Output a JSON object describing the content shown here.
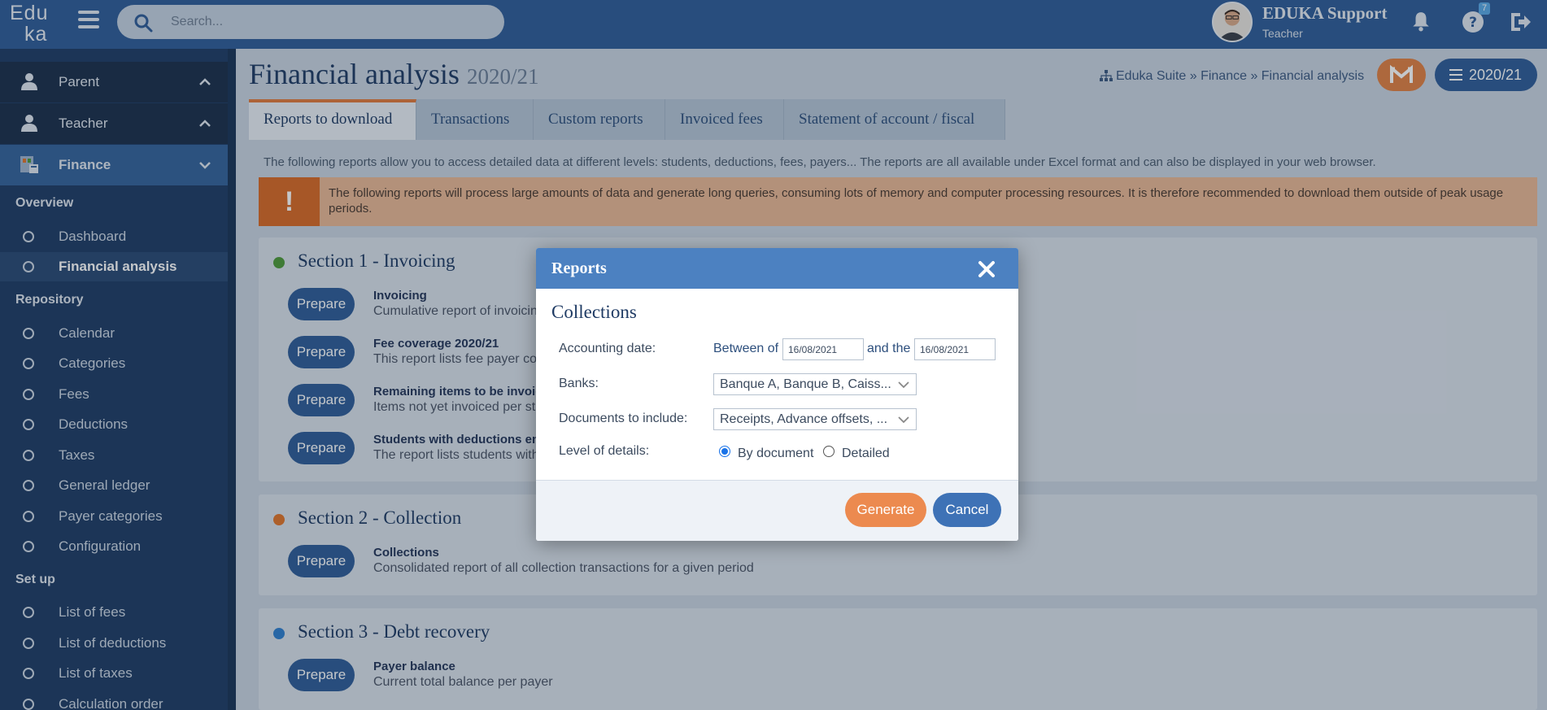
{
  "app": {
    "logo_line1": "Edu",
    "logo_line2": "ka",
    "search_placeholder": "Search...",
    "user_name": "EDUKA Support",
    "user_role": "Teacher",
    "help_badge": "7"
  },
  "sidebar": {
    "rows": [
      {
        "label": "Parent"
      },
      {
        "label": "Teacher"
      },
      {
        "label": "Finance"
      }
    ],
    "sections": [
      {
        "heading": "Overview",
        "items": [
          "Dashboard",
          "Financial analysis"
        ]
      },
      {
        "heading": "Repository",
        "items": [
          "Calendar",
          "Categories",
          "Fees",
          "Deductions",
          "Taxes",
          "General ledger",
          "Payer categories",
          "Configuration"
        ]
      },
      {
        "heading": "Set up",
        "items": [
          "List of fees",
          "List of deductions",
          "List of taxes",
          "Calculation order"
        ]
      }
    ]
  },
  "main": {
    "title": "Financial analysis",
    "title_year": "2020/21",
    "breadcrumb": "Eduka Suite » Finance » Financial analysis",
    "year_button": "2020/21",
    "tabs": [
      "Reports to download",
      "Transactions",
      "Custom reports",
      "Invoiced fees",
      "Statement of account / fiscal"
    ],
    "intro": "The following reports allow you to access detailed data at different levels: students, deductions, fees, payers... The reports are all available under Excel format and can also be displayed in your web browser.",
    "warning": "The following reports will process large amounts of data and generate long queries, consuming lots of memory and computer processing resources. It is therefore recommended to download them outside of peak usage periods.",
    "prepare_label": "Prepare",
    "sections": [
      {
        "title": "Section 1 - Invoicing",
        "reports": [
          {
            "name": "Invoicing",
            "desc": "Cumulative report of invoicing, g"
          },
          {
            "name": "Fee coverage 2020/21",
            "desc": "This report lists fee payer cover"
          },
          {
            "name": "Remaining items to be invoiced",
            "desc": "Items not yet invoiced per stude"
          },
          {
            "name": "Students with deductions enabl",
            "desc": "The report lists students with at"
          }
        ]
      },
      {
        "title": "Section 2 - Collection",
        "reports": [
          {
            "name": "Collections",
            "desc": "Consolidated report of all collection transactions for a given period"
          }
        ]
      },
      {
        "title": "Section 3 - Debt recovery",
        "reports": [
          {
            "name": "Payer balance",
            "desc": "Current total balance per payer"
          }
        ]
      }
    ]
  },
  "modal": {
    "title": "Reports",
    "subtitle": "Collections",
    "accounting_label": "Accounting date:",
    "between_label": "Between of",
    "date_from": "16/08/2021",
    "and_label": "and the",
    "date_to": "16/08/2021",
    "banks_label": "Banks:",
    "banks_value": "Banque A, Banque B, Caiss...",
    "docs_label": "Documents to include:",
    "docs_value": "Receipts, Advance offsets, ...",
    "level_label": "Level of details:",
    "opt_by_document": "By document",
    "opt_detailed": "Detailed",
    "generate": "Generate",
    "cancel": "Cancel"
  },
  "colors": {
    "section1_dot": "#4e9a3a",
    "section2_dot": "#e0742a",
    "section3_dot": "#2f7fcf"
  }
}
